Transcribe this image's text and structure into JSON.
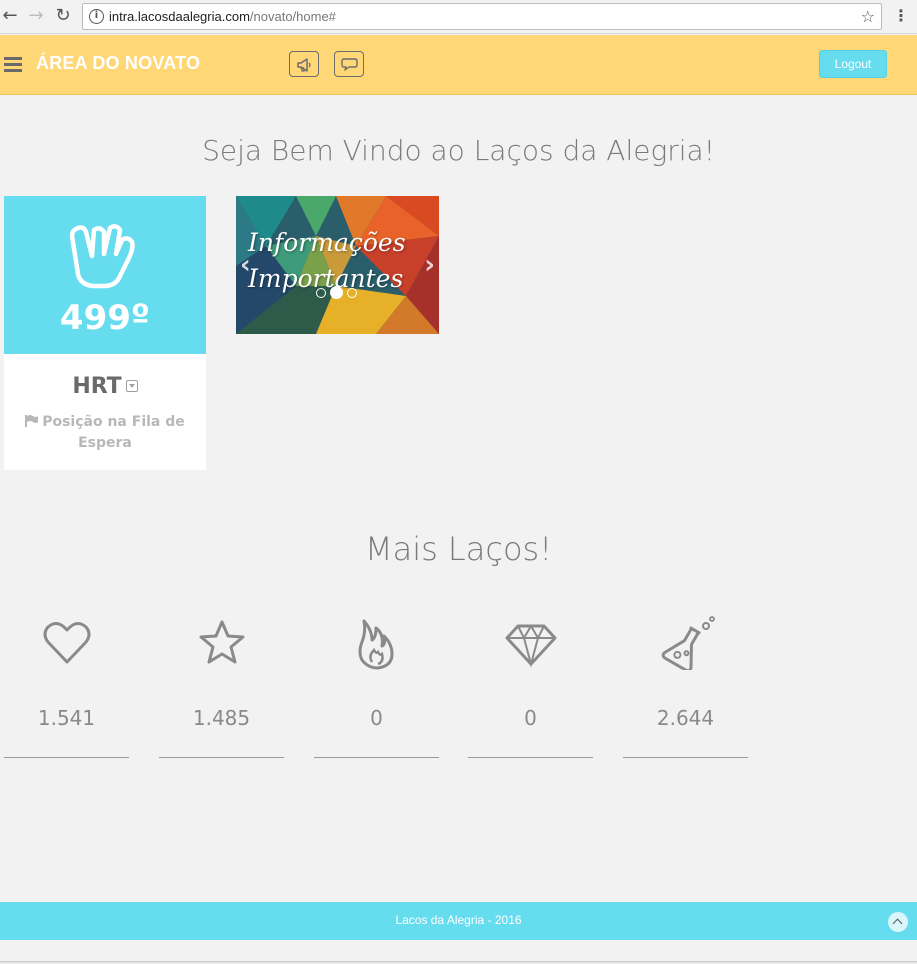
{
  "browser": {
    "url_host": "intra.lacosdaalegria.com",
    "url_path": "/novato/home#"
  },
  "header": {
    "title": "ÁREA DO NOVATO",
    "logout_label": "Logout",
    "icons": [
      "megaphone-icon",
      "chat-bubble-icon",
      "menu-icon"
    ]
  },
  "main": {
    "welcome": "Seja Bem Vindo ao Laços da Alegria!",
    "queue_card": {
      "position": "499º",
      "code": "HRT",
      "label": "Posição na Fila de Espera",
      "accent": "#66dcef"
    },
    "carousel": {
      "line1": "Informações",
      "line2": "Importantes",
      "slides": 3,
      "active_slide": 2
    },
    "more_title": "Mais Laços!",
    "stats": [
      {
        "icon": "heart-icon",
        "value": "1.541"
      },
      {
        "icon": "star-icon",
        "value": "1.485"
      },
      {
        "icon": "flame-icon",
        "value": "0"
      },
      {
        "icon": "diamond-icon",
        "value": "0"
      },
      {
        "icon": "flask-icon",
        "value": "2.644"
      }
    ]
  },
  "footer": {
    "text": "Lacos da Alegria - 2016"
  },
  "colors": {
    "header_bg": "#ffd776",
    "accent": "#66dcef",
    "page_bg": "#f2f2f2"
  }
}
